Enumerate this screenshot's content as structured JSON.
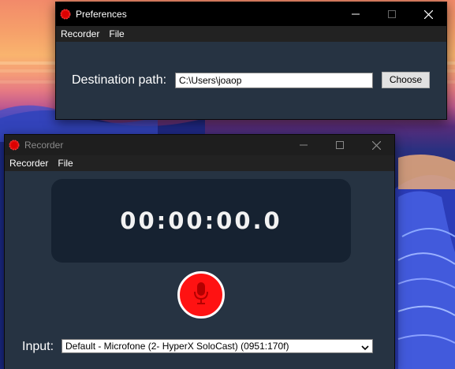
{
  "preferences_window": {
    "title": "Preferences",
    "menu": [
      "Recorder",
      "File"
    ],
    "destination_label": "Destination path:",
    "destination_value": "C:\\Users\\joaop",
    "choose_label": "Choose"
  },
  "recorder_window": {
    "title": "Recorder",
    "menu": [
      "Recorder",
      "File"
    ],
    "timer": "00:00:00.0",
    "input_label": "Input:",
    "input_selected": "Default - Microfone (2- HyperX SoloCast) (0951:170f)"
  },
  "colors": {
    "window_bg": "#263342",
    "timer_panel_bg": "#162231",
    "record_red": "#ff1212",
    "titlebar_active": "#000000"
  },
  "icons": {
    "app": "red-gear-icon",
    "record": "microphone-icon",
    "minimize": "minimize-icon",
    "maximize": "maximize-icon",
    "close": "close-icon"
  }
}
